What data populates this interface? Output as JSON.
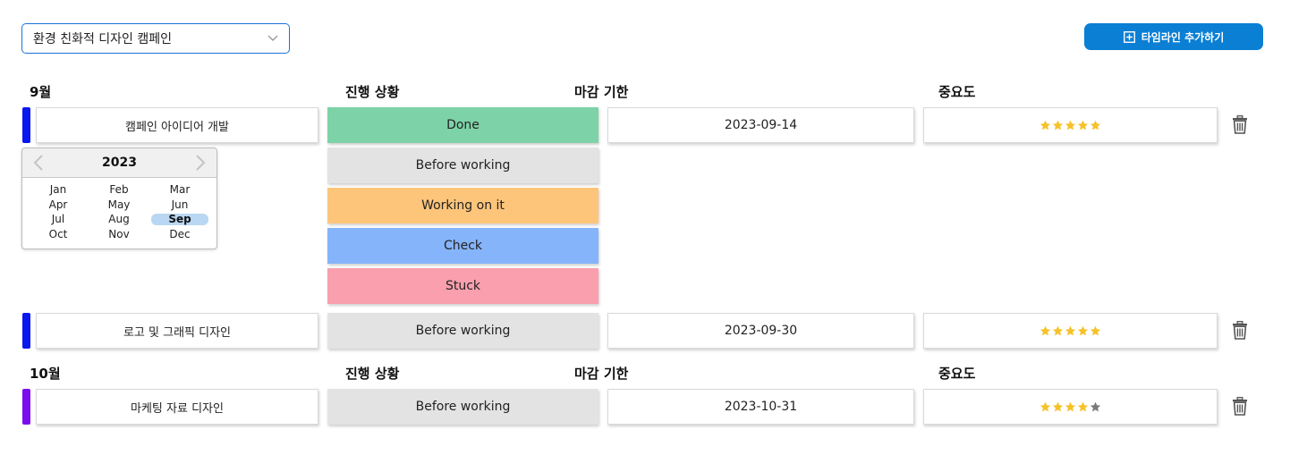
{
  "campaign_select": {
    "value": "환경 친화적 디자인 캠페인",
    "icon": "chevron-down-icon"
  },
  "add_button": {
    "label": "타임라인 추가하기",
    "icon": "plus-square-icon"
  },
  "groups": [
    {
      "month": "9월",
      "status_header": "진행 상황",
      "deadline_header": "마감 기한",
      "priority_header": "중요도",
      "color": "#0a17f0"
    },
    {
      "month": "10월",
      "status_header": "진행 상황",
      "deadline_header": "마감 기한",
      "priority_header": "중요도",
      "color": "#7a0df0"
    }
  ],
  "tasks": [
    {
      "name": "캠페인 아이디어 개발",
      "status": "Done",
      "deadline": "2023-09-14",
      "rating": 5,
      "max_rating": 5
    },
    {
      "name": "로고 및 그래픽 디자인",
      "status": "Before working",
      "deadline": "2023-09-30",
      "rating": 5,
      "max_rating": 5
    },
    {
      "name": "마케팅 자료 디자인",
      "status": "Before working",
      "deadline": "2023-10-31",
      "rating": 4,
      "max_rating": 5
    }
  ],
  "status_options": [
    {
      "label": "Before working",
      "color": "#e3e3e3"
    },
    {
      "label": "Working on it",
      "color": "#fdc57a"
    },
    {
      "label": "Check",
      "color": "#86b4fb"
    },
    {
      "label": "Stuck",
      "color": "#f99fae"
    }
  ],
  "status_colors": {
    "Done": "#7dd3a7",
    "Before working": "#e3e3e3"
  },
  "month_picker": {
    "year": "2023",
    "selected": "Sep",
    "months": [
      "Jan",
      "Feb",
      "Mar",
      "Apr",
      "May",
      "Jun",
      "Jul",
      "Aug",
      "Sep",
      "Oct",
      "Nov",
      "Dec"
    ]
  },
  "colors": {
    "star_filled": "#f6c22a",
    "star_empty": "#7a7a7a",
    "accent": "#0b7fd4"
  }
}
